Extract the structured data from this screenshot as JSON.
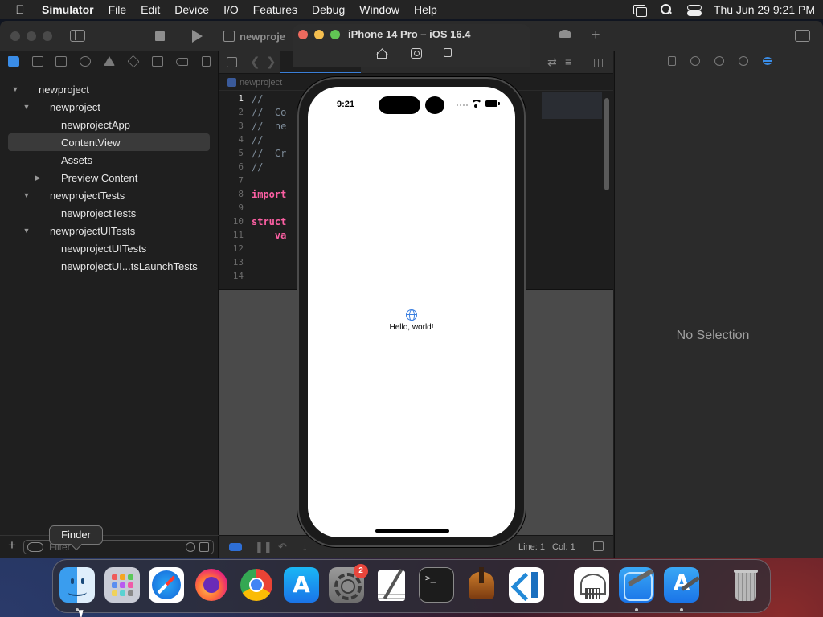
{
  "menubar": {
    "app_name": "Simulator",
    "items": [
      "File",
      "Edit",
      "Device",
      "I/O",
      "Features",
      "Debug",
      "Window",
      "Help"
    ],
    "clock": "Thu Jun 29  9:21 PM"
  },
  "toolbar": {
    "scheme_label": "newproje"
  },
  "navigator": {
    "tree": [
      {
        "label": "newproject",
        "level": 0,
        "chevron": "down"
      },
      {
        "label": "newproject",
        "level": 1,
        "chevron": "down"
      },
      {
        "label": "newprojectApp",
        "level": 2,
        "chevron": "none"
      },
      {
        "label": "ContentView",
        "level": 2,
        "chevron": "none",
        "selected": true
      },
      {
        "label": "Assets",
        "level": 2,
        "chevron": "none"
      },
      {
        "label": "Preview Content",
        "level": 2,
        "chevron": "right"
      },
      {
        "label": "newprojectTests",
        "level": 1,
        "chevron": "down"
      },
      {
        "label": "newprojectTests",
        "level": 2,
        "chevron": "none"
      },
      {
        "label": "newprojectUITests",
        "level": 1,
        "chevron": "down"
      },
      {
        "label": "newprojectUITests",
        "level": 2,
        "chevron": "none"
      },
      {
        "label": "newprojectUI...tsLaunchTests",
        "level": 2,
        "chevron": "none"
      }
    ],
    "filter_placeholder": "Filter"
  },
  "editor": {
    "breadcrumb": "newproject",
    "lines": [
      {
        "num": "1",
        "text": "//"
      },
      {
        "num": "2",
        "text": "//  Co"
      },
      {
        "num": "3",
        "text": "//  ne"
      },
      {
        "num": "4",
        "text": "//"
      },
      {
        "num": "5",
        "text": "//  Cr"
      },
      {
        "num": "6",
        "text": "//"
      },
      {
        "num": "7",
        "text": ""
      },
      {
        "num": "8",
        "text": "import",
        "keyword": true
      },
      {
        "num": "9",
        "text": ""
      },
      {
        "num": "10",
        "text": "struct",
        "keyword": true
      },
      {
        "num": "11",
        "text": "    va",
        "keyword": true
      },
      {
        "num": "12",
        "text": ""
      },
      {
        "num": "13",
        "text": ""
      },
      {
        "num": "14",
        "text": ""
      }
    ],
    "status": {
      "line_label": "Line: 1",
      "col_label": "Col: 1"
    }
  },
  "inspector": {
    "empty_text": "No Selection"
  },
  "simulator": {
    "title": "iPhone 14 Pro – iOS 16.4",
    "status_time": "9:21",
    "content_text": "Hello, world!"
  },
  "tooltip": {
    "text": "Finder"
  },
  "dock": {
    "apps": [
      {
        "name": "finder",
        "running": true
      },
      {
        "name": "launchpad",
        "running": false
      },
      {
        "name": "safari",
        "running": false
      },
      {
        "name": "firefox",
        "running": false
      },
      {
        "name": "chrome",
        "running": false
      },
      {
        "name": "app-store",
        "running": false
      },
      {
        "name": "system-settings",
        "running": false,
        "badge": "2"
      },
      {
        "name": "textedit",
        "running": false
      },
      {
        "name": "terminal",
        "running": false
      },
      {
        "name": "instruments",
        "running": false
      },
      {
        "name": "vscode",
        "running": false
      },
      {
        "name": "accessibility-inspector",
        "running": false
      },
      {
        "name": "xcode",
        "running": true
      },
      {
        "name": "simulator",
        "running": true
      },
      {
        "name": "trash",
        "running": false
      }
    ]
  },
  "colors": {
    "accent": "#3a7fd8",
    "keyword": "#fc5fa3",
    "badge": "#e8463c"
  }
}
